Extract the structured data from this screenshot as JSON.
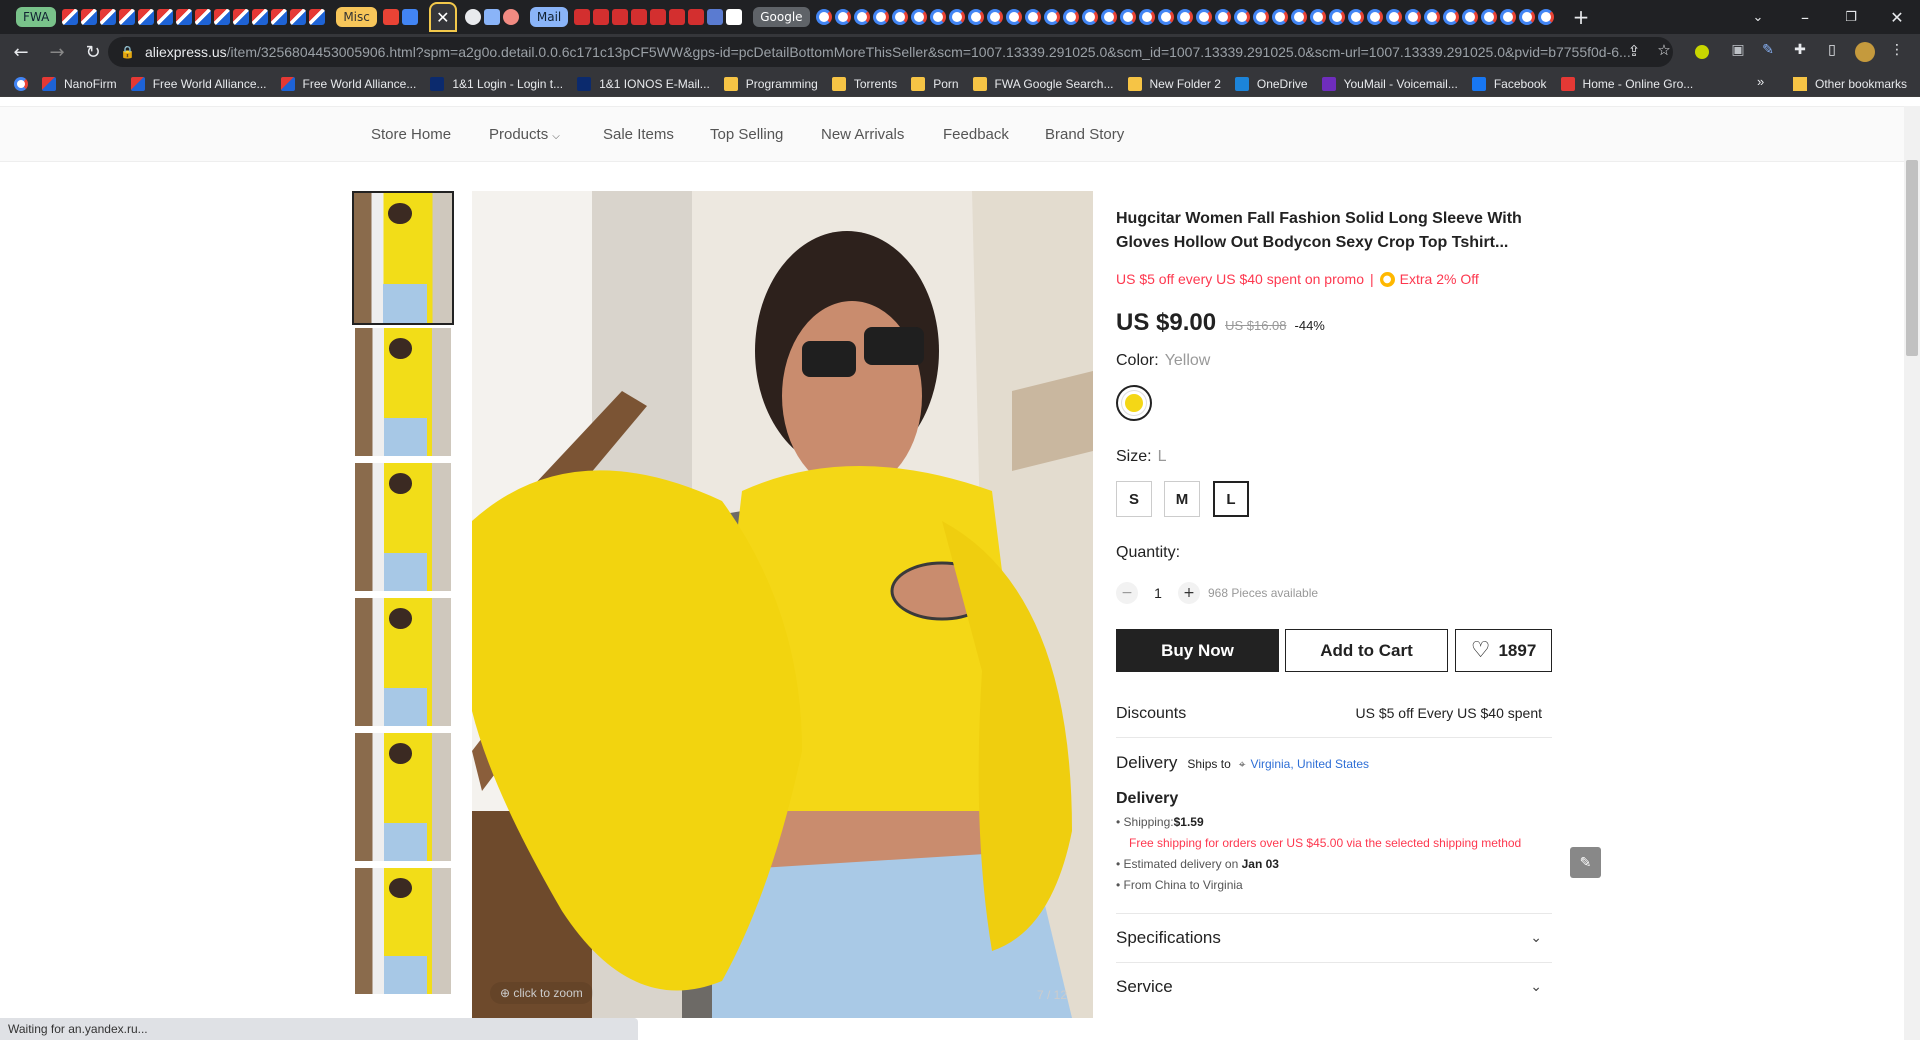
{
  "browser": {
    "tab_groups": [
      {
        "label": "FWA",
        "color": "#79c28a",
        "text_color": "#123"
      },
      {
        "label": "Misc",
        "color": "#f7c65a",
        "text_color": "#333"
      },
      {
        "label": "Mail",
        "color": "#8ab4f8",
        "text_color": "#123"
      },
      {
        "label": "Google",
        "color": "#5f6368",
        "text_color": "#fff"
      }
    ],
    "new_tab_label": "+",
    "close_tab_label": "✕",
    "url_host": "aliexpress.us",
    "url_rest": "/item/3256804453005906.html?spm=a2g0o.detail.0.0.6c171c13pCF5WW&gps-id=pcDetailBottomMoreThisSeller&scm=1007.13339.291025.0&scm_id=1007.13339.291025.0&scm-url=1007.13339.291025.0&pvid=b7755f0d-6..."
  },
  "bookmarks": {
    "items": [
      {
        "label": "NanoFirm",
        "icon": "fwa-icon"
      },
      {
        "label": "Free World Alliance...",
        "icon": "fwa-icon"
      },
      {
        "label": "Free World Alliance...",
        "icon": "fwa-icon"
      },
      {
        "label": "1&1 Login - Login t...",
        "icon": "ionos-icon"
      },
      {
        "label": "1&1 IONOS E-Mail...",
        "icon": "ionos-icon"
      },
      {
        "label": "Programming",
        "icon": "folder-icon"
      },
      {
        "label": "Torrents",
        "icon": "folder-icon"
      },
      {
        "label": "Porn",
        "icon": "folder-icon"
      },
      {
        "label": "FWA Google Search...",
        "icon": "folder-icon"
      },
      {
        "label": "New Folder 2",
        "icon": "folder-icon"
      },
      {
        "label": "OneDrive",
        "icon": "onedrive-icon"
      },
      {
        "label": "YouMail - Voicemail...",
        "icon": "yahoo-icon"
      },
      {
        "label": "Facebook",
        "icon": "facebook-icon"
      },
      {
        "label": "Home - Online Gro...",
        "icon": "grocery-icon"
      }
    ],
    "more": "»",
    "other": "Other bookmarks"
  },
  "store_nav": {
    "items": [
      "Store Home",
      "Products",
      "Sale Items",
      "Top Selling",
      "New Arrivals",
      "Feedback",
      "Brand Story"
    ]
  },
  "gallery": {
    "zoom_hint": "click to zoom",
    "counter": "7 / 12",
    "thumb_count": 6
  },
  "product": {
    "title": "Hugcitar Women Fall Fashion Solid Long Sleeve With Gloves Hollow Out Bodycon Sexy Crop Top Tshirt...",
    "promo": "US $5 off every US $40 spent on promo",
    "promo_sep": "|",
    "extra_off": "Extra 2% Off",
    "price": "US $9.00",
    "old_price": "US $16.08",
    "discount": "-44%",
    "color_label": "Color:",
    "color_value": "Yellow",
    "size_label": "Size:",
    "size_value": "L",
    "sizes": [
      "S",
      "M",
      "L"
    ],
    "quantity_label": "Quantity:",
    "quantity": "1",
    "available": "968 Pieces available",
    "buy_now": "Buy Now",
    "add_to_cart": "Add to Cart",
    "wishlist_count": "1897",
    "accent_color": "#fd384f"
  },
  "discounts": {
    "label": "Discounts",
    "value": "US $5 off Every US $40 spent"
  },
  "delivery": {
    "label": "Delivery",
    "ships_to": "Ships to",
    "location": "Virginia, United States",
    "heading": "Delivery",
    "shipping_label": "Shipping:",
    "shipping_value": "$1.59",
    "free_shipping": "Free shipping for orders over US $45.00 via the selected shipping method",
    "est_label": "Estimated delivery on",
    "est_value": "Jan 03",
    "from": "From China to Virginia"
  },
  "sections": {
    "specifications": "Specifications",
    "service": "Service"
  },
  "status": "Waiting for an.yandex.ru..."
}
